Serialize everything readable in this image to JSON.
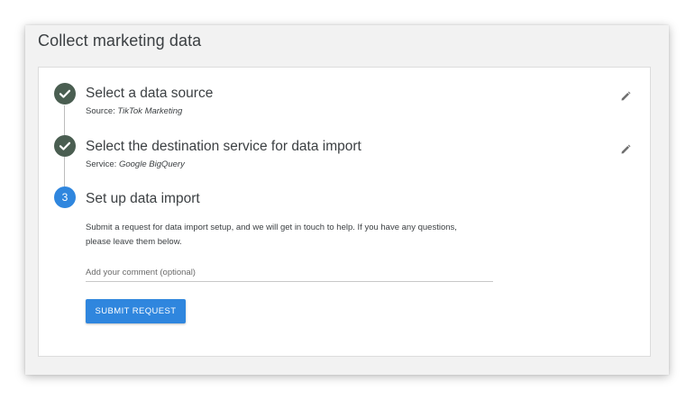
{
  "page": {
    "title": "Collect marketing data"
  },
  "steps": [
    {
      "number": "1",
      "state": "completed",
      "title": "Select a data source",
      "sub_label": "Source:",
      "sub_value": "TikTok Marketing",
      "icon": "check-circle-icon",
      "edit_icon": "pencil-icon"
    },
    {
      "number": "2",
      "state": "completed",
      "title": "Select the destination service for data import",
      "sub_label": "Service:",
      "sub_value": "Google BigQuery",
      "icon": "check-circle-icon",
      "edit_icon": "pencil-icon"
    },
    {
      "number": "3",
      "state": "active",
      "title": "Set up data import",
      "description": "Submit a request for data import setup, and we will get in touch to help. If you have any questions, please leave them below.",
      "comment": {
        "value": "",
        "placeholder": "Add your comment (optional)"
      },
      "submit_label": "SUBMIT REQUEST"
    }
  ],
  "colors": {
    "accent": "#2f86de",
    "completed": "#4a5e51",
    "text": "#3c4043",
    "panel_bg": "#f2f2f2"
  }
}
